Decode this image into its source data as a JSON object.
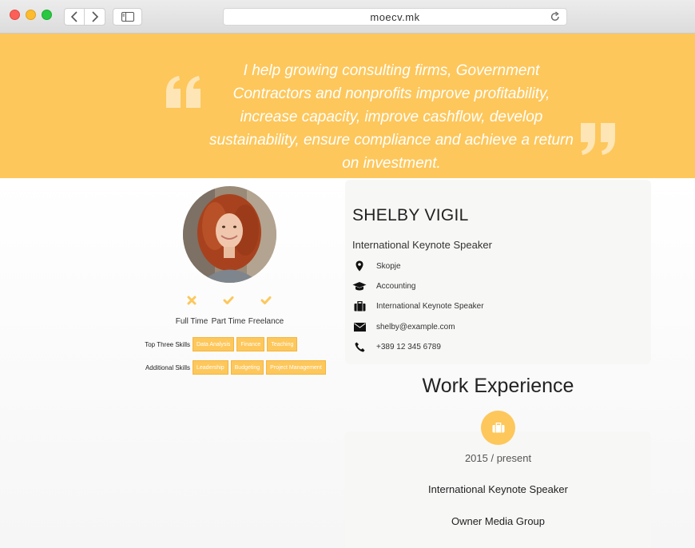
{
  "browser": {
    "url": "moecv.mk"
  },
  "hero": {
    "quote": "I help growing consulting firms, Government Contractors and nonprofits improve profitability, increase capacity, improve cashflow, develop sustainability, ensure compliance and achieve a return on investment."
  },
  "availability": [
    {
      "label": "Full Time",
      "state": "no",
      "icon": "cross-icon"
    },
    {
      "label": "Part Time",
      "state": "yes",
      "icon": "check-icon"
    },
    {
      "label": "Freelance",
      "state": "yes",
      "icon": "check-icon"
    }
  ],
  "skills": {
    "top_label": "Top Three Skills",
    "top": [
      "Data Analysis",
      "Finance",
      "Teaching"
    ],
    "additional_label": "Additional Skills",
    "additional": [
      "Leadership",
      "Budgeting",
      "Project Management"
    ]
  },
  "profile": {
    "name": "SHELBY VIGIL",
    "title": "International Keynote Speaker",
    "details": [
      {
        "icon": "location-pin-icon",
        "text": "Skopje"
      },
      {
        "icon": "graduation-cap-icon",
        "text": "Accounting"
      },
      {
        "icon": "briefcase-icon",
        "text": "International Keynote Speaker"
      },
      {
        "icon": "envelope-icon",
        "text": "shelby@example.com"
      },
      {
        "icon": "phone-icon",
        "text": "+389 12 345 6789"
      }
    ]
  },
  "work": {
    "heading": "Work Experience",
    "entries": [
      {
        "dates": "2015 / present",
        "role": "International Keynote Speaker",
        "company": "Owner Media Group"
      }
    ]
  },
  "colors": {
    "accent": "#fdc75b"
  }
}
